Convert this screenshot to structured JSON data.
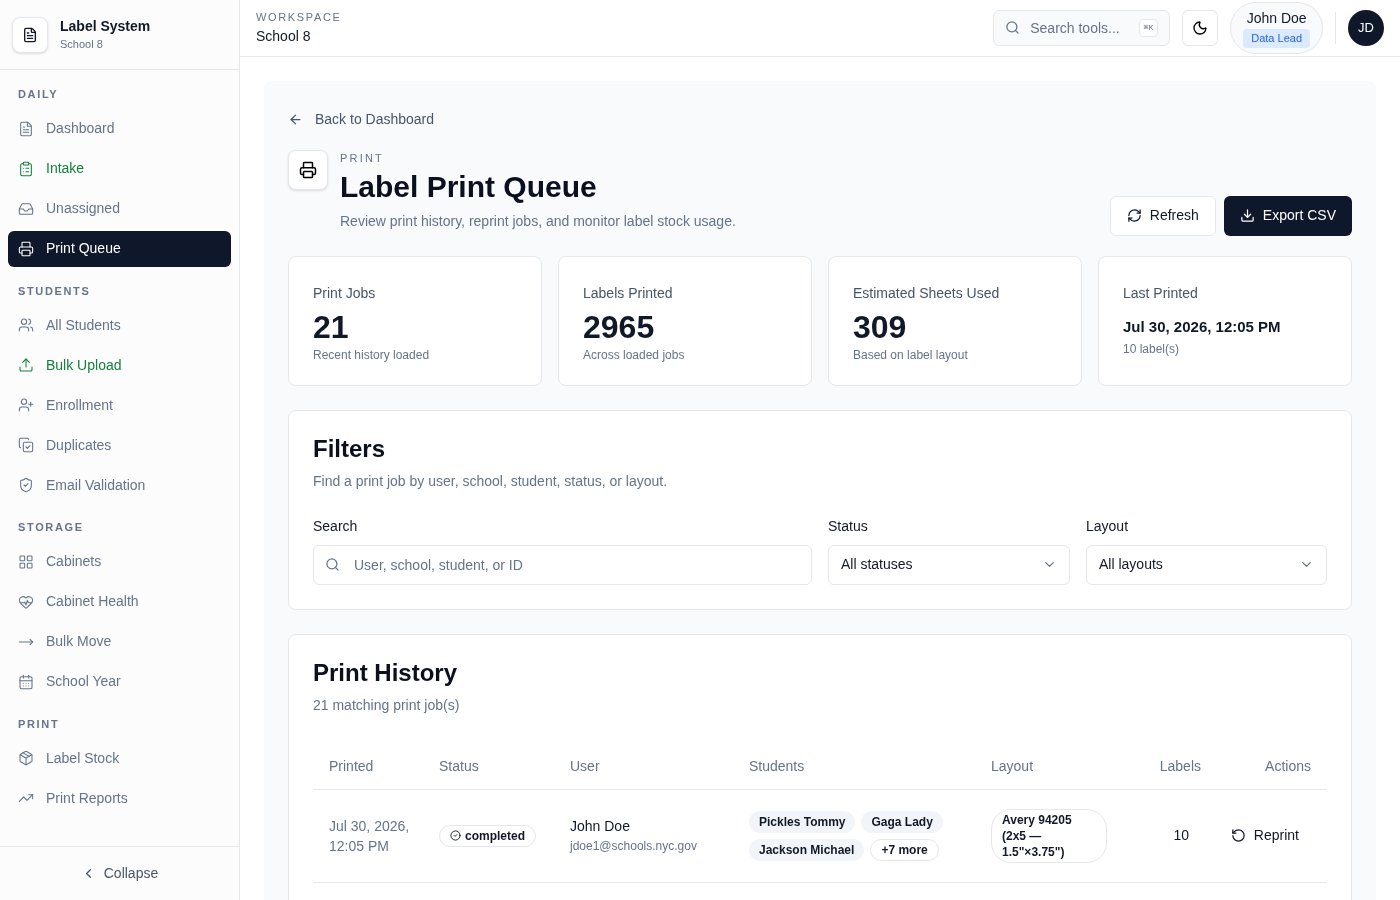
{
  "brand": {
    "title": "Label System",
    "subtitle": "School 8"
  },
  "sidebar": {
    "sections": [
      {
        "heading": "DAILY",
        "items": [
          {
            "label": "Dashboard",
            "accent": false,
            "selected": false
          },
          {
            "label": "Intake",
            "accent": true,
            "selected": false
          },
          {
            "label": "Unassigned",
            "accent": false,
            "selected": false
          },
          {
            "label": "Print Queue",
            "accent": false,
            "selected": true
          }
        ]
      },
      {
        "heading": "STUDENTS",
        "items": [
          {
            "label": "All Students",
            "accent": false,
            "selected": false
          },
          {
            "label": "Bulk Upload",
            "accent": true,
            "selected": false
          },
          {
            "label": "Enrollment",
            "accent": false,
            "selected": false
          },
          {
            "label": "Duplicates",
            "accent": false,
            "selected": false
          },
          {
            "label": "Email Validation",
            "accent": false,
            "selected": false
          }
        ]
      },
      {
        "heading": "STORAGE",
        "items": [
          {
            "label": "Cabinets",
            "accent": false,
            "selected": false
          },
          {
            "label": "Cabinet Health",
            "accent": false,
            "selected": false
          },
          {
            "label": "Bulk Move",
            "accent": false,
            "selected": false
          },
          {
            "label": "School Year",
            "accent": false,
            "selected": false
          }
        ]
      },
      {
        "heading": "PRINT",
        "items": [
          {
            "label": "Label Stock",
            "accent": false,
            "selected": false
          },
          {
            "label": "Print Reports",
            "accent": false,
            "selected": false
          }
        ]
      }
    ],
    "collapse": "Collapse"
  },
  "header": {
    "workspace_label": "WORKSPACE",
    "workspace": "School 8",
    "search_placeholder": "Search tools...",
    "shortcut": "⌘K",
    "user_name": "John Doe",
    "user_role": "Data Lead",
    "avatar": "JD"
  },
  "page": {
    "back": "Back to Dashboard",
    "eyebrow": "PRINT",
    "title": "Label Print Queue",
    "subtitle": "Review print history, reprint jobs, and monitor label stock usage.",
    "buttons": [
      {
        "label": "Refresh",
        "kind": "secondary"
      },
      {
        "label": "Export CSV",
        "kind": "primary"
      }
    ]
  },
  "stats": [
    {
      "label": "Print Jobs",
      "value": "21",
      "note": "Recent history loaded",
      "kind": "big"
    },
    {
      "label": "Labels Printed",
      "value": "2965",
      "note": "Across loaded jobs",
      "kind": "big"
    },
    {
      "label": "Estimated Sheets Used",
      "value": "309",
      "note": "Based on label layout",
      "kind": "big"
    },
    {
      "label": "Last Printed",
      "value": "Jul 30, 2026, 12:05 PM",
      "note": "10 label(s)",
      "kind": "small"
    }
  ],
  "filters": {
    "title": "Filters",
    "subtitle": "Find a print job by user, school, student, status, or layout.",
    "search": {
      "label": "Search",
      "placeholder": "User, school, student, or ID"
    },
    "status": {
      "label": "Status",
      "value": "All statuses"
    },
    "layout": {
      "label": "Layout",
      "value": "All layouts"
    }
  },
  "history": {
    "title": "Print History",
    "subtitle": "21 matching print job(s)",
    "columns": [
      "Printed",
      "Status",
      "User",
      "Students",
      "Layout",
      "Labels",
      "Actions"
    ],
    "rows": [
      {
        "printed": "Jul 30, 2026, 12:05 PM",
        "status": "completed",
        "user": "John Doe",
        "email": "jdoe1@schools.nyc.gov",
        "students": [
          "Pickles Tommy",
          "Gaga Lady",
          "Jackson Michael"
        ],
        "more": "+7 more",
        "layout": "Avery 94205 (2x5 — 1.5\"×3.75\")",
        "labels": "10",
        "action": "Reprint"
      }
    ]
  }
}
